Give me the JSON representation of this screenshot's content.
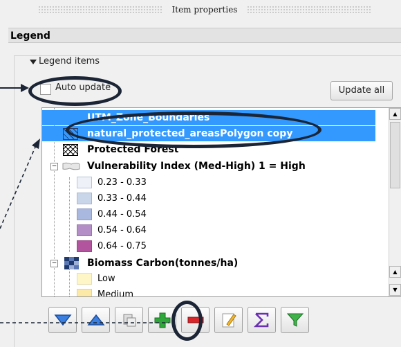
{
  "window": {
    "title": "Item properties"
  },
  "section": {
    "header": "Legend"
  },
  "group": {
    "title": "Legend items"
  },
  "auto_update": {
    "label": "Auto update",
    "checked": false
  },
  "update_all": {
    "label": "Update all"
  },
  "tree": {
    "rows": [
      {
        "label": "UTM_Zone_Boundaries",
        "selected": true
      },
      {
        "label": "natural_protected_areasPolygon copy",
        "selected": true
      },
      {
        "label": "Protected Forest"
      },
      {
        "label": "Vulnerability Index (Med-High) 1 = High"
      },
      {
        "label": "0.23 - 0.33",
        "color": "#eef1f8"
      },
      {
        "label": "0.33 - 0.44",
        "color": "#c9d6ea"
      },
      {
        "label": "0.44 - 0.54",
        "color": "#a9b8de"
      },
      {
        "label": "0.54 - 0.64",
        "color": "#b48ec6"
      },
      {
        "label": "0.64 - 0.75",
        "color": "#b3559e"
      },
      {
        "label": "Biomass Carbon(tonnes/ha)"
      },
      {
        "label": "Low",
        "color": "#fef6c7"
      },
      {
        "label": "Medium",
        "color": "#fde9a7"
      }
    ]
  },
  "toolbar": {
    "buttons": [
      "move-down-icon",
      "move-up-icon",
      "group-icon",
      "add-icon",
      "remove-icon",
      "edit-icon",
      "sum-icon",
      "filter-icon"
    ]
  },
  "colors": {
    "selection": "#3399ff",
    "callout": "#1b2535"
  }
}
